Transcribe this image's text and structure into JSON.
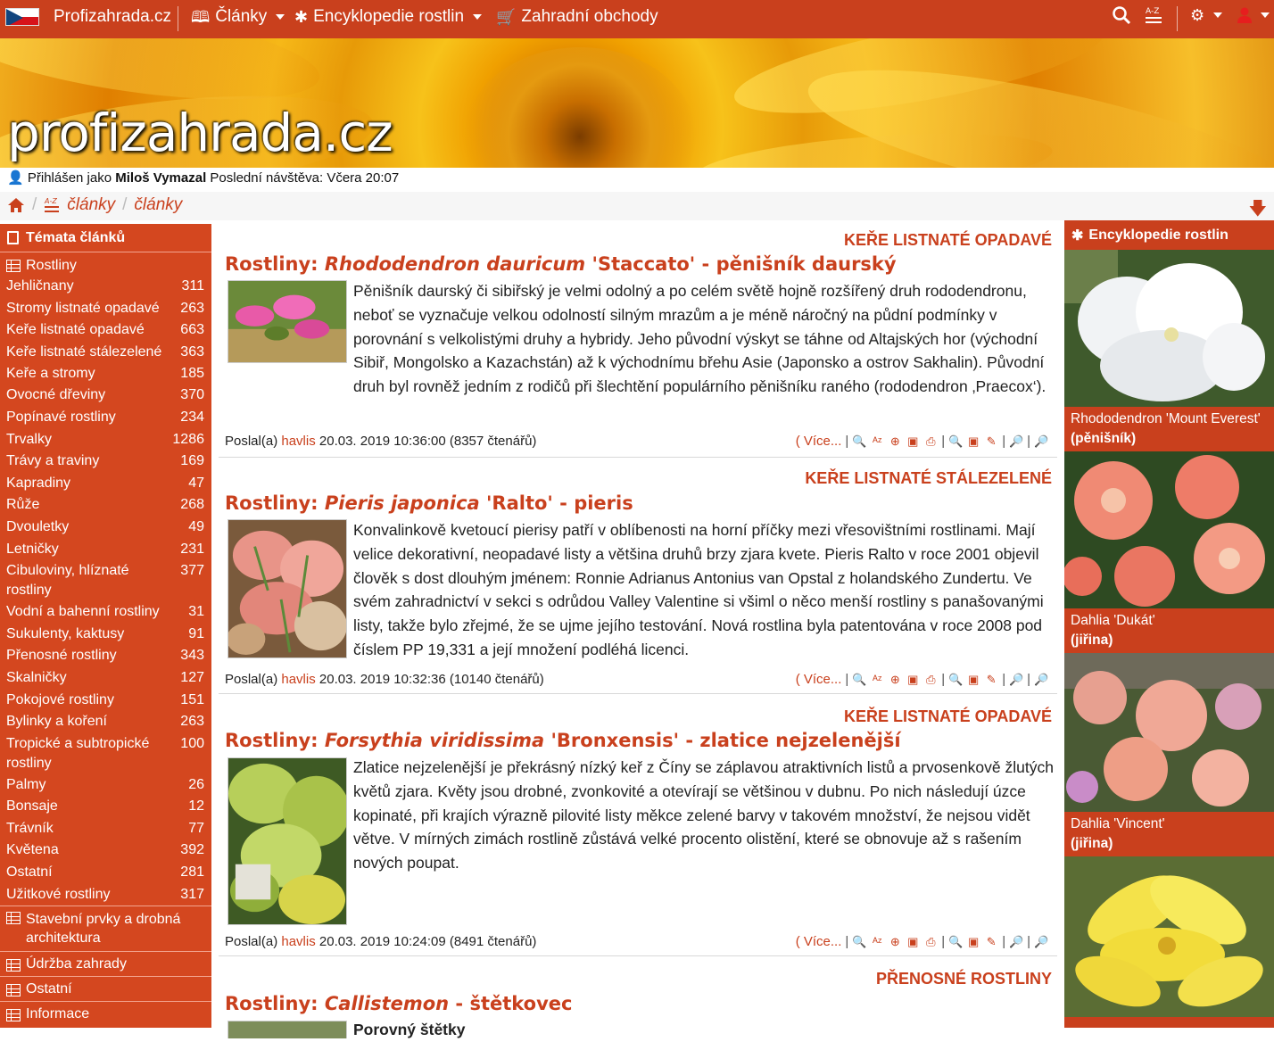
{
  "topnav": {
    "brand": "Profizahrada.cz",
    "items": [
      {
        "label": "Články",
        "icon": "book-icon"
      },
      {
        "label": "Encyklopedie rostlin",
        "icon": "asterisk-icon"
      },
      {
        "label": "Zahradní obchody",
        "icon": "cart-icon"
      }
    ],
    "right_icons": [
      "search-icon",
      "az-icon",
      "gear-icon",
      "user-icon"
    ]
  },
  "banner": {
    "logo_text": "profizahrada.cz"
  },
  "userline": {
    "prefix": "Přihlášen jako",
    "user": "Miloš Vymazal",
    "last_visit_label": "Poslední návštěva:",
    "last_visit": "Včera 20:07"
  },
  "breadcrumb": {
    "items": [
      "články",
      "články"
    ]
  },
  "leftbar": {
    "title": "Témata článků",
    "section_rostliny": "Rostliny",
    "items": [
      {
        "label": "Jehličnany",
        "count": "311"
      },
      {
        "label": "Stromy listnaté opadavé",
        "count": "263"
      },
      {
        "label": "Keře listnaté opadavé",
        "count": "663"
      },
      {
        "label": "Keře listnaté stálezelené",
        "count": "363"
      },
      {
        "label": "Keře a stromy",
        "count": "185"
      },
      {
        "label": "Ovocné dřeviny",
        "count": "370"
      },
      {
        "label": "Popínavé rostliny",
        "count": "234"
      },
      {
        "label": "Trvalky",
        "count": "1286"
      },
      {
        "label": "Trávy a traviny",
        "count": "169"
      },
      {
        "label": "Kapradiny",
        "count": "47"
      },
      {
        "label": "Růže",
        "count": "268"
      },
      {
        "label": "Dvouletky",
        "count": "49"
      },
      {
        "label": "Letničky",
        "count": "231"
      },
      {
        "label": "Cibuloviny, hlíznaté rostliny",
        "count": "377"
      },
      {
        "label": "Vodní a bahenní rostliny",
        "count": "31"
      },
      {
        "label": "Sukulenty, kaktusy",
        "count": "91"
      },
      {
        "label": "Přenosné rostliny",
        "count": "343"
      },
      {
        "label": "Skalničky",
        "count": "127"
      },
      {
        "label": "Pokojové rostliny",
        "count": "151"
      },
      {
        "label": "Bylinky a koření",
        "count": "263"
      },
      {
        "label": "Tropické a subtropické rostliny",
        "count": "100"
      },
      {
        "label": "Palmy",
        "count": "26"
      },
      {
        "label": "Bonsaje",
        "count": "12"
      },
      {
        "label": "Trávník",
        "count": "77"
      },
      {
        "label": "Květena",
        "count": "392"
      },
      {
        "label": "Ostatní",
        "count": "281"
      },
      {
        "label": "Užitkové rostliny",
        "count": "317"
      }
    ],
    "sections": [
      "Stavební prvky a drobná architektura",
      "Údržba zahrady",
      "Ostatní",
      "Informace"
    ]
  },
  "articles": [
    {
      "category": "KEŘE LISTNATÉ OPADAVÉ",
      "prefix": "Rostliny:",
      "latin": "Rhododendron dauricum",
      "rest": "'Staccato' - pěnišník daurský",
      "text": "Pěnišník daurský či sibiřský je velmi odolný a po celém světě hojně rozšířený druh rododendronu, neboť se vyznačuje velkou odolností silným mrazům a je méně náročný na půdní podmínky v porovnání s velkolistými druhy a hybridy. Jeho původní výskyt se táhne od Altajských hor (východní Sibiř, Mongolsko a Kazachstán) až k východnímu břehu Asie (Japonsko a ostrov Sakhalin). Původní druh byl rovněž jedním z rodičů při šlechtění populárního pěnišníku raného (rododendron ‚Praecox‘).",
      "meta_prefix": "Poslal(a)",
      "author": "havlis",
      "meta_rest": "20.03. 2019 10:36:00 (8357 čtenářů)",
      "more": "( Více..."
    },
    {
      "category": "KEŘE LISTNATÉ STÁLEZELENÉ",
      "prefix": "Rostliny:",
      "latin": "Pieris japonica",
      "rest": "'Ralto' - pieris",
      "text": "Konvalinkově kvetoucí pierisy patří v oblíbenosti na horní příčky mezi vřesovištními rostlinami. Mají velice dekorativní, neopadavé listy a většina druhů brzy zjara kvete. Pieris Ralto v roce 2001 objevil člověk s dost dlouhým jménem: Ronnie Adrianus Antonius van Opstal z holandského Zundertu. Ve svém zahradnictví v sekci s odrůdou Valley Valentine si všiml o něco menší rostliny s panašovanými listy, takže bylo zřejmé, že se ujme jejího testování. Nová rostlina byla patentována v roce 2008 pod číslem PP 19,331 a její množení podléhá licenci.",
      "meta_prefix": "Poslal(a)",
      "author": "havlis",
      "meta_rest": "20.03. 2019 10:32:36 (10140 čtenářů)",
      "more": "( Více..."
    },
    {
      "category": "KEŘE LISTNATÉ OPADAVÉ",
      "prefix": "Rostliny:",
      "latin": "Forsythia viridissima",
      "rest": "'Bronxensis' - zlatice nejzelenější",
      "text": "Zlatice nejzelenější je překrásný nízký keř z Číny se záplavou atraktivních listů a prvosenkově žlutých květů zjara. Květy jsou drobné, zvonkovité a otevírají se většinou v dubnu. Po nich následují úzce kopinaté, při krajích výrazně pilovité listy měkce zelené barvy v takovém množství, že nejsou vidět větve. V mírných zimách rostlině zůstává velké procento olistění, které se obnovuje až s rašením nových poupat.",
      "meta_prefix": "Poslal(a)",
      "author": "havlis",
      "meta_rest": "20.03. 2019 10:24:09 (8491 čtenářů)",
      "more": "( Více..."
    },
    {
      "category": "PŘENOSNÉ ROSTLINY",
      "prefix": "Rostliny:",
      "latin": "Callistemon",
      "rest": "- štětkovec",
      "text": "Porovný štětky"
    }
  ],
  "rightbar": {
    "title": "Encyklopedie rostlin",
    "plants": [
      {
        "name": "Rhododendron 'Mount Everest'",
        "common": "(pěnišník)"
      },
      {
        "name": "Dahlia 'Dukát'",
        "common": "(jiřina)"
      },
      {
        "name": "Dahlia 'Vincent'",
        "common": "(jiřina)"
      }
    ]
  },
  "colors": {
    "accent": "#c9401d",
    "sidebar": "#d4471f"
  }
}
